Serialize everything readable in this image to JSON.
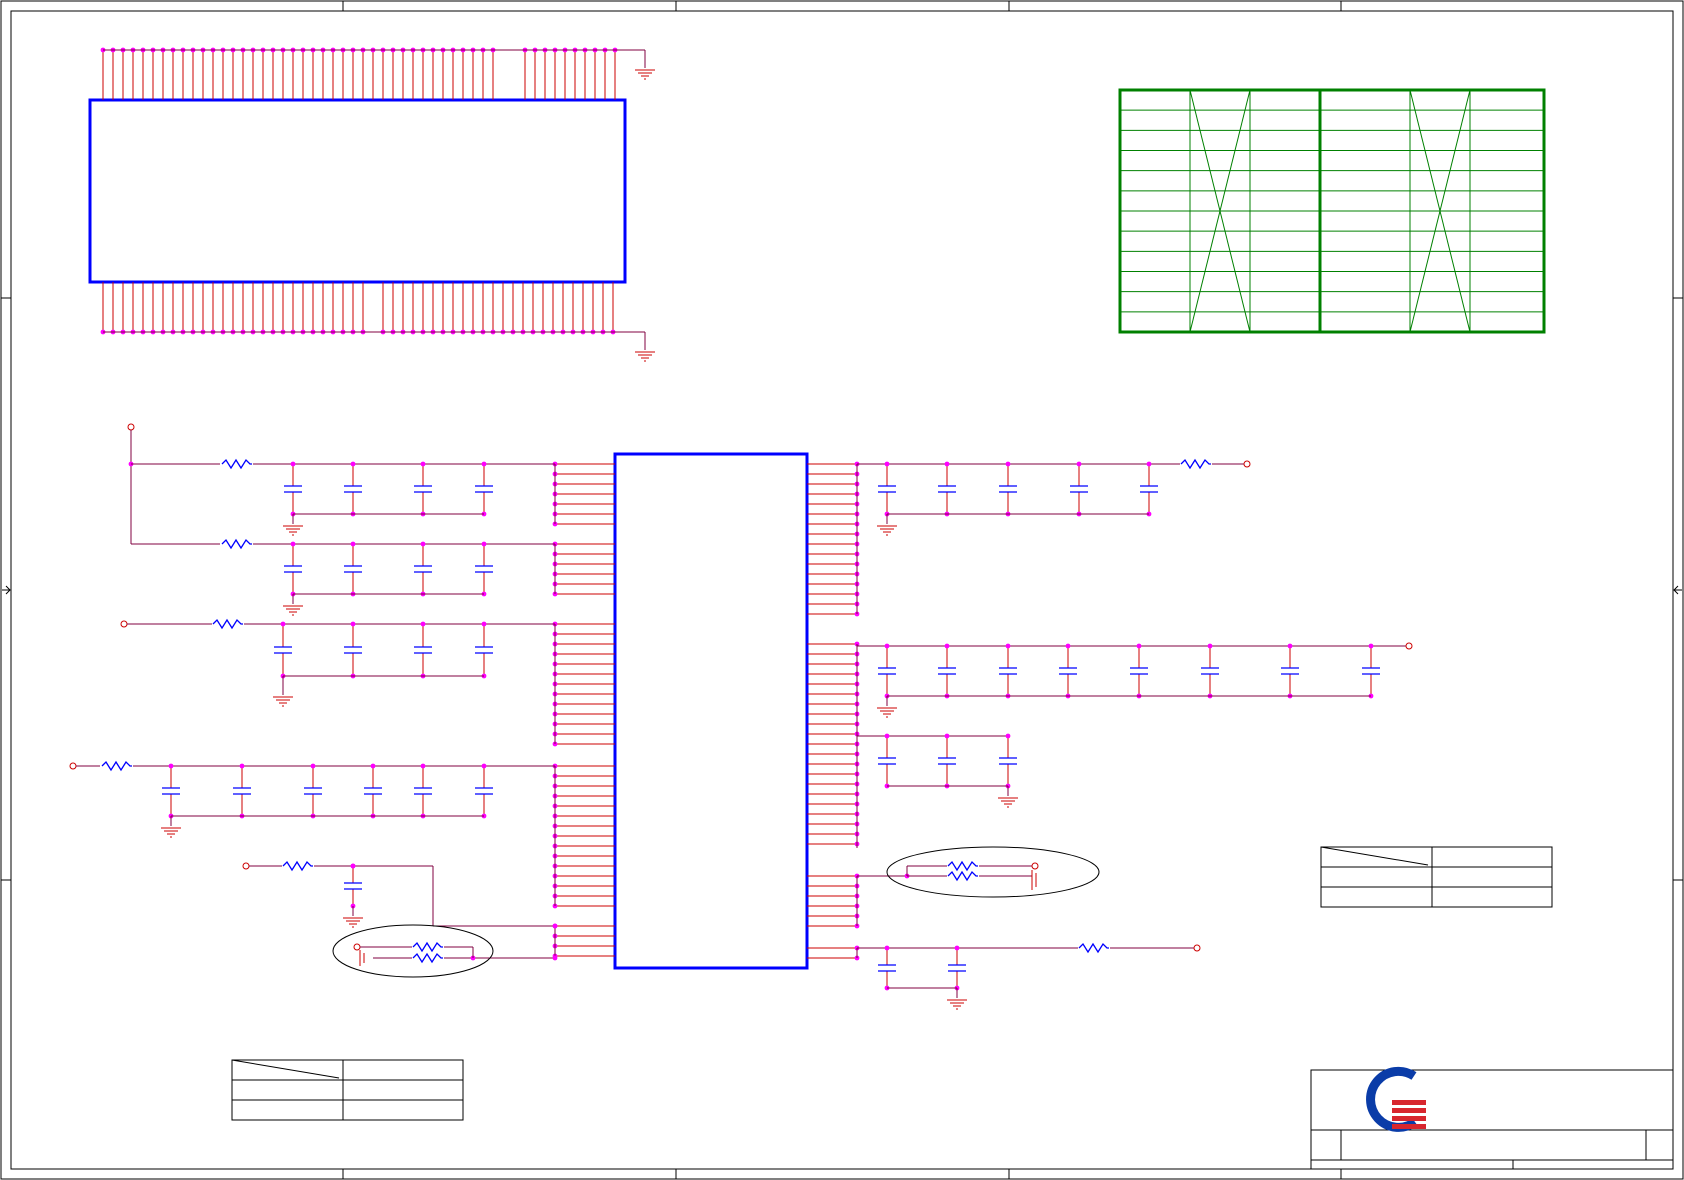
{
  "sheet": {
    "border_color": "#000000",
    "wire_color": "#cc0000",
    "net_color": "#800040",
    "node_color": "#ff00ff",
    "ic_color": "#0000ff",
    "table_color": "#008000",
    "logo_blue": "#0a3ca8",
    "logo_red": "#d8262e"
  },
  "tables": {
    "green_table_rows": 12
  }
}
